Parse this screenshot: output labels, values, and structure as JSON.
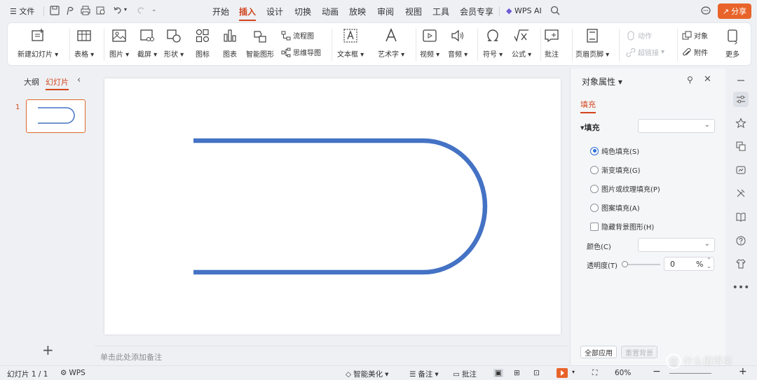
{
  "titlebar": {
    "file_menu": "文件",
    "menu_tabs": [
      "开始",
      "插入",
      "设计",
      "切换",
      "动画",
      "放映",
      "审阅",
      "视图",
      "工具",
      "会员专享"
    ],
    "active_tab": "插入",
    "wps_ai": "WPS AI",
    "share": "分享"
  },
  "ribbon": {
    "new_slide": "新建幻灯片",
    "table": "表格",
    "picture": "图片",
    "screenshot": "截屏",
    "shape": "形状",
    "icon": "图标",
    "chart": "图表",
    "smart_art": "智能图形",
    "flowchart": "流程图",
    "mindmap": "思维导图",
    "textbox": "文本框",
    "wordart": "艺术字",
    "video": "视频",
    "audio": "音频",
    "symbol": "符号",
    "formula": "公式",
    "comment": "批注",
    "header_footer": "页眉页脚",
    "action": "动作",
    "hyperlink": "超链接",
    "object": "对象",
    "attachment": "附件",
    "more": "更多"
  },
  "leftpanel": {
    "tab_outline": "大纲",
    "tab_slides": "幻灯片",
    "slide_number": "1"
  },
  "notes": {
    "placeholder": "单击此处添加备注"
  },
  "rpanel": {
    "title": "对象属性",
    "tab_fill": "填充",
    "section_fill": "填充",
    "fill_options": [
      {
        "label": "纯色填充(S)",
        "selected": true
      },
      {
        "label": "渐变填充(G)",
        "selected": false
      },
      {
        "label": "图片或纹理填充(P)",
        "selected": false
      },
      {
        "label": "图案填充(A)",
        "selected": false
      }
    ],
    "hide_bg": "隐藏背景图形(H)",
    "color_label": "颜色(C)",
    "transparency_label": "透明度(T)",
    "transparency_value": "0",
    "transparency_unit": "%",
    "apply_all": "全部应用",
    "reset_bg": "重置背景"
  },
  "statusbar": {
    "slide_info": "幻灯片 1 / 1",
    "wps": "WPS",
    "smart_beautify": "智能美化",
    "notes": "备注",
    "comments": "批注",
    "zoom": "60%"
  },
  "watermark": {
    "text": "什么值得买",
    "badge": "值"
  },
  "colors": {
    "accent": "#d2451c",
    "share_bg": "#e8632a",
    "shape_stroke": "#4472c4"
  }
}
